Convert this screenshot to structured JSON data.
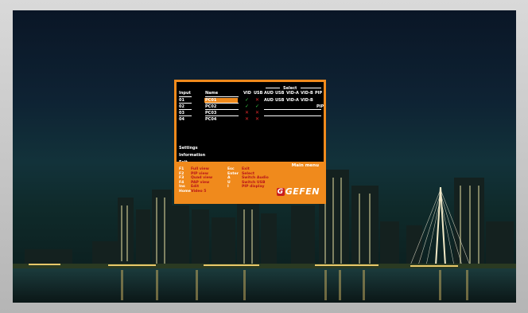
{
  "osd": {
    "headers": {
      "input": "Input",
      "name": "Name",
      "vid": "VID",
      "usb": "USB",
      "select": "Select",
      "aud": "AUD",
      "usb2": "USB",
      "vida": "VID-A",
      "vidb": "VID-B",
      "pip": "PIP"
    },
    "rows": [
      {
        "input": "01",
        "name": "PC01",
        "vid": "check",
        "usb": "x"
      },
      {
        "input": "02",
        "name": "PC02",
        "vid": "check",
        "usb": "check"
      },
      {
        "input": "03",
        "name": "PC03",
        "vid": "x",
        "usb": "x"
      },
      {
        "input": "04",
        "name": "PC04",
        "vid": "x",
        "usb": "x"
      }
    ],
    "select_row1": {
      "aud": "AUD",
      "usb": "USB",
      "vida": "VID-A",
      "vidb": "VID-B"
    },
    "select_row2": {
      "pip": "PIP"
    },
    "menu": [
      "Settings",
      "Information",
      "Exit"
    ],
    "main_menu_label": "Main menu",
    "shortcuts_left": [
      {
        "key": "F1",
        "label": "Full view"
      },
      {
        "key": "F2",
        "label": "PIP view"
      },
      {
        "key": "F3",
        "label": "Quad view"
      },
      {
        "key": "F4",
        "label": "PAP view"
      },
      {
        "key": "Ins",
        "label": "Edit"
      },
      {
        "key": "Home",
        "label": "Video 5"
      }
    ],
    "shortcuts_right": [
      {
        "key": "Esc",
        "label": "Exit"
      },
      {
        "key": "Enter",
        "label": "Select"
      },
      {
        "key": "A",
        "label": "Switch Audio"
      },
      {
        "key": "U",
        "label": "Switch USB"
      },
      {
        "key": "I",
        "label": "PIP display"
      }
    ],
    "logo": "GEFEN",
    "logo_mark": "G",
    "colors": {
      "accent": "#f08a1c",
      "check": "#3ad04a",
      "x": "#e0282a",
      "key_value": "#b8131a"
    }
  }
}
